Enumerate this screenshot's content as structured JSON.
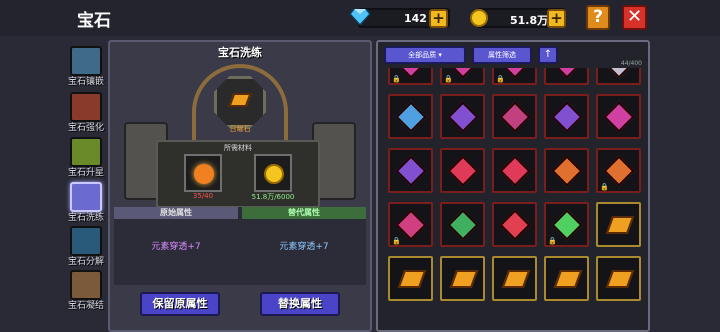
{
  "header": {
    "title": "宝石"
  },
  "resources": {
    "diamonds": "142",
    "coins": "51.8万"
  },
  "icons": {
    "help": "?",
    "close": "✕",
    "plus": "+",
    "sort": "↑"
  },
  "sidebar": {
    "items": [
      {
        "label": "宝石镶嵌",
        "color": "#3f6a8a"
      },
      {
        "label": "宝石强化",
        "color": "#8a3a2a"
      },
      {
        "label": "宝石升星",
        "color": "#6a8a2a"
      },
      {
        "label": "宝石洗练",
        "color": "#6a6ad0"
      },
      {
        "label": "宝石分解",
        "color": "#2a5a7a"
      },
      {
        "label": "宝石凝结",
        "color": "#7a5a3a"
      }
    ]
  },
  "left_panel": {
    "title": "宝石洗练",
    "stone_name": "日曜石",
    "materials_title": "所需材料",
    "material1_count": "35/40",
    "material2_count": "51.8万/6000",
    "attr_original_header": "原始属性",
    "attr_replace_header": "替代属性",
    "attr_original_value": "元素穿透+7",
    "attr_replace_value": "元素穿透+7",
    "btn_keep": "保留原属性",
    "btn_replace": "替换属性"
  },
  "right_panel": {
    "quality_filter": "全部品质",
    "attr_filter": "属性筛选",
    "count": "44/400",
    "cells": [
      {
        "type": "gem",
        "color": "#d040a0",
        "lock": true,
        "gold": false
      },
      {
        "type": "gem",
        "color": "#d040a0",
        "lock": true,
        "gold": false
      },
      {
        "type": "gem",
        "color": "#d040a0",
        "lock": true,
        "gold": false
      },
      {
        "type": "gem",
        "color": "#d040a0",
        "lock": false,
        "gold": false
      },
      {
        "type": "gem",
        "color": "#c0c0d0",
        "lock": false,
        "gold": false
      },
      {
        "type": "gem",
        "color": "#4fa0e0",
        "lock": false,
        "gold": false
      },
      {
        "type": "gem",
        "color": "#8050d0",
        "lock": false,
        "gold": false
      },
      {
        "type": "gem",
        "color": "#c04080",
        "lock": false,
        "gold": false
      },
      {
        "type": "gem",
        "color": "#8050d0",
        "lock": false,
        "gold": false
      },
      {
        "type": "gem",
        "color": "#d040a0",
        "lock": false,
        "gold": false
      },
      {
        "type": "gem",
        "color": "#8050d0",
        "lock": false,
        "gold": false
      },
      {
        "type": "gem",
        "color": "#e03a5a",
        "lock": false,
        "gold": false
      },
      {
        "type": "gem",
        "color": "#e03a5a",
        "lock": false,
        "gold": false
      },
      {
        "type": "gem",
        "color": "#e07030",
        "lock": false,
        "gold": false
      },
      {
        "type": "gem",
        "color": "#e07030",
        "lock": true,
        "gold": false
      },
      {
        "type": "gem",
        "color": "#d04080",
        "lock": true,
        "gold": false
      },
      {
        "type": "gem",
        "color": "#40b060",
        "lock": false,
        "gold": false
      },
      {
        "type": "gem",
        "color": "#e04050",
        "lock": false,
        "gold": false
      },
      {
        "type": "gem",
        "color": "#50d060",
        "lock": true,
        "gold": false
      },
      {
        "type": "shard",
        "color": "#f0a020",
        "lock": false,
        "gold": true
      },
      {
        "type": "shard",
        "color": "#f0a020",
        "lock": false,
        "gold": true
      },
      {
        "type": "shard",
        "color": "#f0a020",
        "lock": false,
        "gold": true
      },
      {
        "type": "shard",
        "color": "#f0a020",
        "lock": false,
        "gold": true
      },
      {
        "type": "shard",
        "color": "#f0a020",
        "lock": false,
        "gold": true
      },
      {
        "type": "shard",
        "color": "#f0a020",
        "lock": false,
        "gold": true
      }
    ]
  },
  "colors": {
    "accent": "#4a45c8",
    "gold": "#f3c51e",
    "attr_original": "#d88cff",
    "attr_replace": "#8ac8ff"
  }
}
